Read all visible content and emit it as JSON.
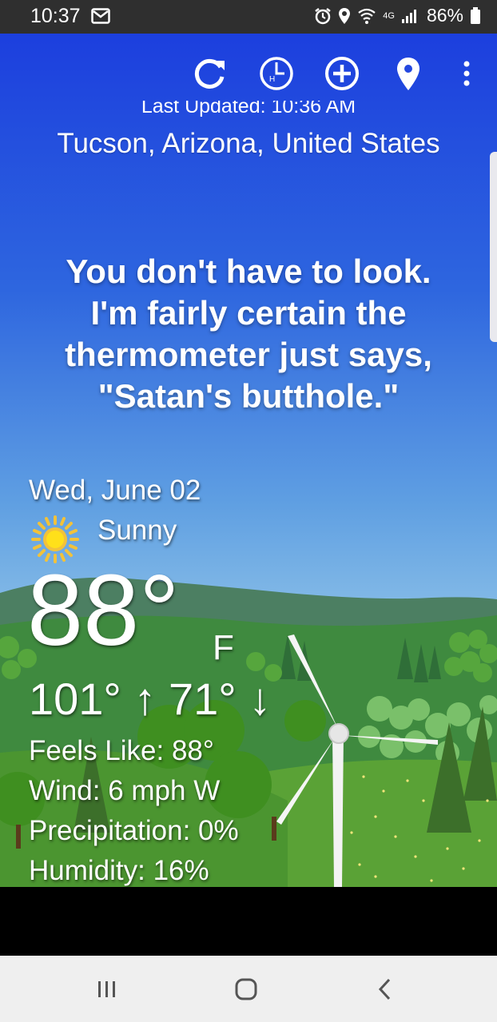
{
  "status_bar": {
    "time": "10:37",
    "network": "4G",
    "battery": "86%"
  },
  "toolbar": {
    "refresh_icon": "refresh-icon",
    "history_icon": "clock-history-icon",
    "add_icon": "add-location-icon",
    "location_icon": "location-pin-icon",
    "menu_icon": "more-vert-icon"
  },
  "header": {
    "last_updated": "Last Updated: 10:36 AM",
    "location": "Tucson, Arizona, United States"
  },
  "quote": {
    "lines": [
      "You don't have to look.",
      "I'm fairly certain the",
      "thermometer just says,",
      "\"Satan's butthole.\""
    ]
  },
  "weather": {
    "date": "Wed, June 02",
    "condition": "Sunny",
    "condition_icon": "sun-icon",
    "temperature": "88°",
    "unit": "F",
    "high_low": "101° ↑ 71° ↓",
    "feels_like": "Feels Like: 88°",
    "wind": "Wind: 6 mph W",
    "precipitation": "Precipitation: 0%",
    "humidity": "Humidity: 16%"
  },
  "colors": {
    "sky_top": "#1c3fde",
    "sky_bottom": "#b6dbed",
    "grass": "#4f9a2c",
    "status_bar": "#2f2f2f",
    "nav_bar": "#efefef"
  }
}
